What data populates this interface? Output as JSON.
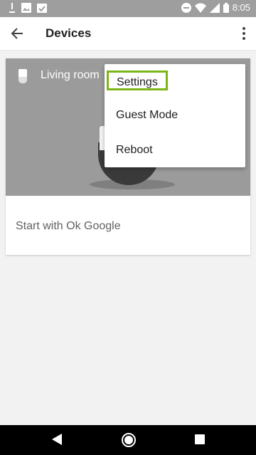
{
  "status_bar": {
    "time": "8:05",
    "left_icons": [
      "download-icon",
      "image-icon",
      "checklist-icon"
    ],
    "right_icons": [
      "dnd-icon",
      "wifi-icon",
      "signal-icon",
      "battery-icon"
    ]
  },
  "app_bar": {
    "title": "Devices",
    "back_icon": "arrow-back-icon",
    "overflow_icon": "more-vert-icon"
  },
  "device_card": {
    "device_name": "Living room",
    "device_icon": "speaker-icon",
    "action_label": "Start with Ok Google"
  },
  "menu": {
    "items": [
      {
        "label": "Settings",
        "highlighted": true
      },
      {
        "label": "Guest Mode",
        "highlighted": false
      },
      {
        "label": "Reboot",
        "highlighted": false
      }
    ]
  },
  "nav_bar": {
    "buttons": [
      "back-triangle-icon",
      "home-circle-icon",
      "recents-square-icon"
    ]
  },
  "colors": {
    "highlight": "#7cb518",
    "status_bar": "#9e9e9e",
    "hero": "#9b9b9b"
  }
}
